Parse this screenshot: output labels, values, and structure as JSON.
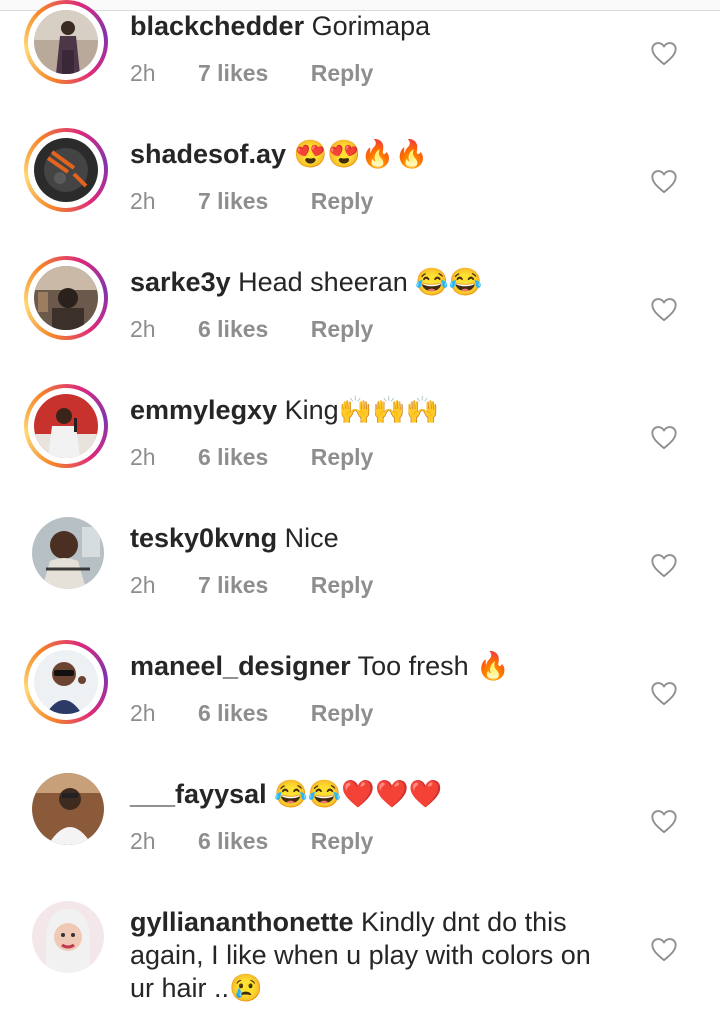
{
  "comments": [
    {
      "username": "blackchedder",
      "text": "Gorimapa",
      "time": "2h",
      "likes": "7 likes",
      "reply": "Reply",
      "story_ring": true,
      "avatar": "woman-standing"
    },
    {
      "username": "shadesof.ay",
      "text": "😍😍🔥🔥",
      "time": "2h",
      "likes": "7 likes",
      "reply": "Reply",
      "story_ring": true,
      "avatar": "dark-orange-art"
    },
    {
      "username": "sarke3y",
      "text": "Head sheeran 😂😂",
      "time": "2h",
      "likes": "6 likes",
      "reply": "Reply",
      "story_ring": true,
      "avatar": "car-interior"
    },
    {
      "username": "emmylegxy",
      "text": "King🙌🙌🙌",
      "time": "2h",
      "likes": "6 likes",
      "reply": "Reply",
      "story_ring": true,
      "avatar": "man-with-mic"
    },
    {
      "username": "tesky0kvng",
      "text": "Nice",
      "time": "2h",
      "likes": "7 likes",
      "reply": "Reply",
      "story_ring": false,
      "avatar": "man-portrait"
    },
    {
      "username": "maneel_designer",
      "text": "Too fresh 🔥",
      "time": "2h",
      "likes": "6 likes",
      "reply": "Reply",
      "story_ring": true,
      "avatar": "cartoon-man"
    },
    {
      "username": "___fayysal",
      "text": "😂😂❤️❤️❤️",
      "time": "2h",
      "likes": "6 likes",
      "reply": "Reply",
      "story_ring": false,
      "avatar": "man-white-shirt"
    },
    {
      "username": "gyllianant honette",
      "text": "Kindly dnt do this again, I like when u play with colors on ur hair ..😢",
      "time": "",
      "likes": "",
      "reply": "",
      "story_ring": false,
      "avatar": "woman-portrait"
    }
  ],
  "icons": {
    "like": "heart-outline-icon"
  },
  "colors": {
    "username": "#262626",
    "meta": "#8e8e8e",
    "ring_start": "#f58529",
    "ring_end": "#8134af"
  }
}
